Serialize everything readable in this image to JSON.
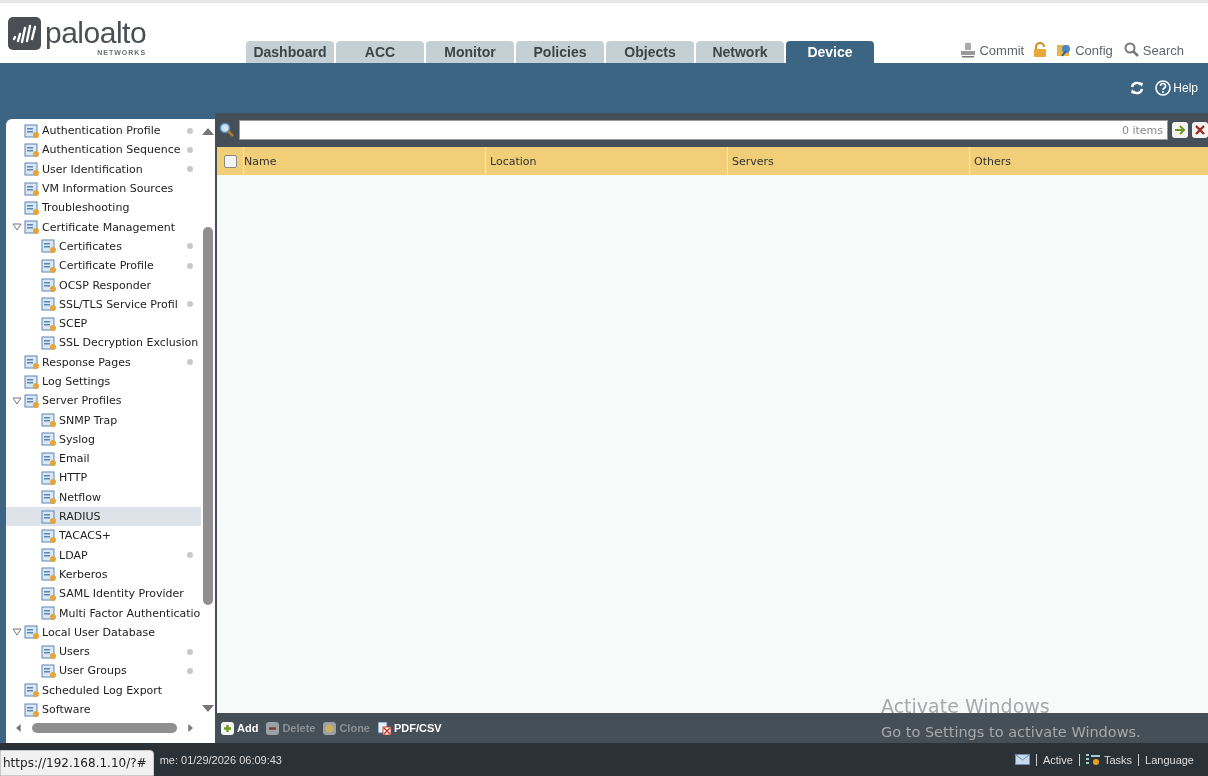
{
  "logo": {
    "name": "paloalto",
    "subtitle": "NETWORKS"
  },
  "tabs": [
    {
      "label": "Dashboard",
      "selected": false
    },
    {
      "label": "ACC",
      "selected": false
    },
    {
      "label": "Monitor",
      "selected": false
    },
    {
      "label": "Policies",
      "selected": false
    },
    {
      "label": "Objects",
      "selected": false
    },
    {
      "label": "Network",
      "selected": false
    },
    {
      "label": "Device",
      "selected": true
    }
  ],
  "header_actions": [
    {
      "kind": "commit",
      "label": "Commit"
    },
    {
      "kind": "lock"
    },
    {
      "kind": "config",
      "label": "Config"
    },
    {
      "kind": "search",
      "label": "Search"
    }
  ],
  "band_actions": [
    {
      "kind": "refresh"
    },
    {
      "kind": "help",
      "label": "Help"
    }
  ],
  "sidebar": {
    "items": [
      {
        "label": "Authentication Profile",
        "dot": true,
        "selected": false
      },
      {
        "label": "Authentication Sequence",
        "dot": true,
        "selected": false
      },
      {
        "label": "User Identification",
        "dot": true,
        "selected": false
      },
      {
        "label": "VM Information Sources",
        "dot": false,
        "selected": false
      },
      {
        "label": "Troubleshooting",
        "dot": false,
        "selected": false
      },
      {
        "label": "Certificate Management",
        "dot": false,
        "selected": false,
        "expanded": true,
        "children": [
          {
            "label": "Certificates",
            "dot": true,
            "selected": false
          },
          {
            "label": "Certificate Profile",
            "dot": true,
            "selected": false
          },
          {
            "label": "OCSP Responder",
            "dot": false,
            "selected": false
          },
          {
            "label": "SSL/TLS Service Profil",
            "dot": true,
            "selected": false
          },
          {
            "label": "SCEP",
            "dot": false,
            "selected": false
          },
          {
            "label": "SSL Decryption Exclusion",
            "dot": false,
            "selected": false
          }
        ]
      },
      {
        "label": "Response Pages",
        "dot": true,
        "selected": false
      },
      {
        "label": "Log Settings",
        "dot": false,
        "selected": false
      },
      {
        "label": "Server Profiles",
        "dot": false,
        "selected": false,
        "expanded": true,
        "children": [
          {
            "label": "SNMP Trap",
            "dot": false,
            "selected": false
          },
          {
            "label": "Syslog",
            "dot": false,
            "selected": false
          },
          {
            "label": "Email",
            "dot": false,
            "selected": false
          },
          {
            "label": "HTTP",
            "dot": false,
            "selected": false
          },
          {
            "label": "Netflow",
            "dot": false,
            "selected": false
          },
          {
            "label": "RADIUS",
            "dot": false,
            "selected": true
          },
          {
            "label": "TACACS+",
            "dot": false,
            "selected": false
          },
          {
            "label": "LDAP",
            "dot": true,
            "selected": false
          },
          {
            "label": "Kerberos",
            "dot": false,
            "selected": false
          },
          {
            "label": "SAML Identity Provider",
            "dot": false,
            "selected": false
          },
          {
            "label": "Multi Factor Authenticatio",
            "dot": false,
            "selected": false
          }
        ]
      },
      {
        "label": "Local User Database",
        "dot": false,
        "selected": false,
        "expanded": true,
        "children": [
          {
            "label": "Users",
            "dot": true,
            "selected": false
          },
          {
            "label": "User Groups",
            "dot": true,
            "selected": false
          }
        ]
      },
      {
        "label": "Scheduled Log Export",
        "dot": false,
        "selected": false
      },
      {
        "label": "Software",
        "dot": false,
        "selected": false
      }
    ]
  },
  "table": {
    "filter": {
      "count": "0 items"
    },
    "select_all": {
      "checked": false
    },
    "columns": [
      "Name",
      "Location",
      "Servers",
      "Others"
    ]
  },
  "actions": [
    {
      "kind": "add",
      "label": "Add",
      "disabled": false
    },
    {
      "kind": "delete",
      "label": "Delete",
      "disabled": true
    },
    {
      "kind": "clone",
      "label": "Clone",
      "disabled": true
    },
    {
      "kind": "pdf",
      "label": "PDF/CSV",
      "disabled": false
    }
  ],
  "status_bar": {
    "url_tooltip": "https://192.168.1.10/?#",
    "time": "me: 01/29/2026 06:09:43",
    "items": [
      {
        "kind": "mail"
      },
      {
        "kind": "text",
        "label": "Active"
      },
      {
        "kind": "tasks",
        "label": "Tasks"
      },
      {
        "kind": "text",
        "label": "Language"
      }
    ]
  },
  "os_overlay": {
    "title": "Activate Windows",
    "subtitle": "Go to Settings to activate Windows."
  }
}
